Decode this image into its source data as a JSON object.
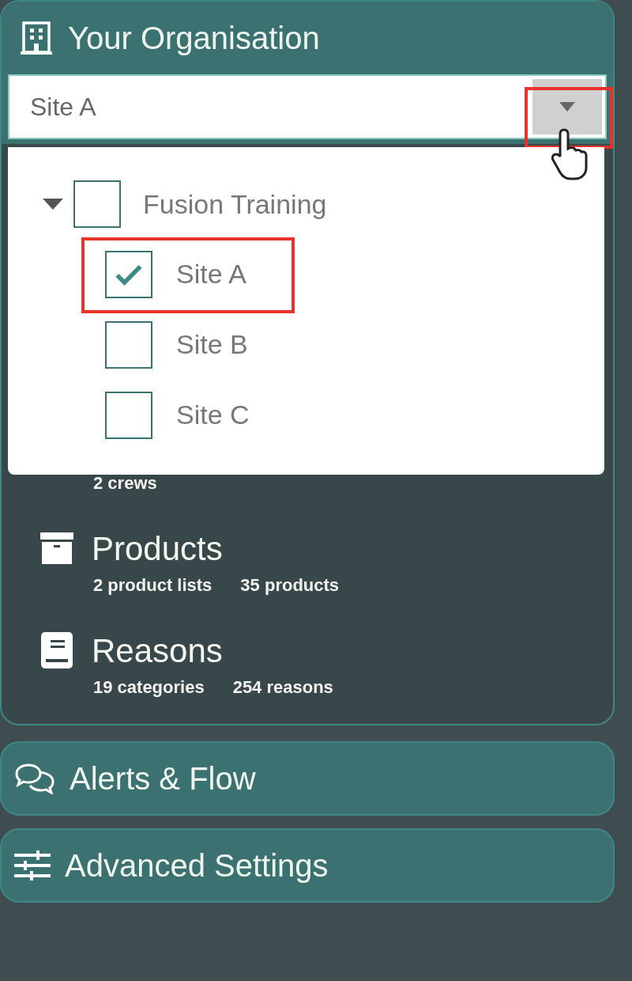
{
  "panel": {
    "title": "Your Organisation",
    "select": {
      "value": "Site A",
      "toggle_highlighted": true
    },
    "tree": [
      {
        "label": "Fusion Training",
        "checked": false,
        "expanded": true,
        "children": [
          {
            "label": "Site A",
            "checked": true,
            "highlighted": true
          },
          {
            "label": "Site B",
            "checked": false,
            "highlighted": false
          },
          {
            "label": "Site C",
            "checked": false,
            "highlighted": false
          }
        ]
      }
    ],
    "sections": [
      {
        "stats": [
          "2 crews"
        ]
      },
      {
        "kind": "products",
        "title": "Products",
        "stats": [
          "2 product lists",
          "35 products"
        ]
      },
      {
        "kind": "reasons",
        "title": "Reasons",
        "stats": [
          "19 categories",
          "254 reasons"
        ]
      }
    ]
  },
  "nav": [
    {
      "kind": "alerts",
      "label": "Alerts & Flow"
    },
    {
      "kind": "settings",
      "label": "Advanced Settings"
    }
  ]
}
